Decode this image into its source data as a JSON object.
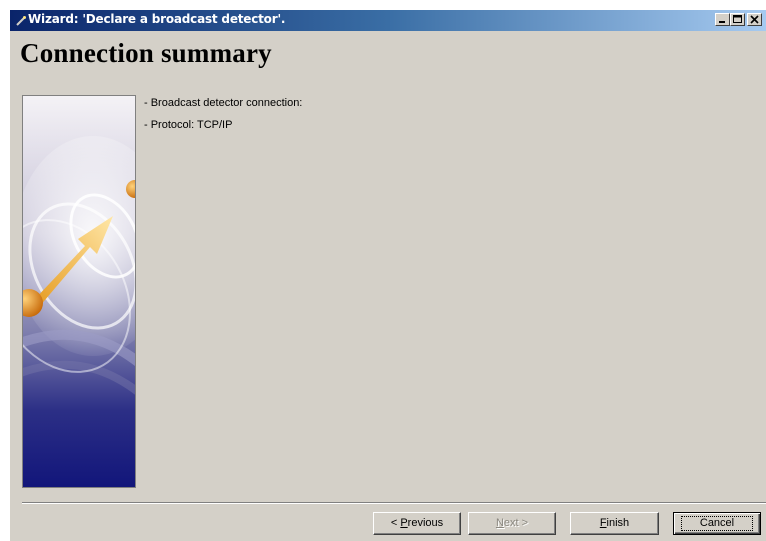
{
  "window": {
    "title": "Wizard: 'Declare a broadcast detector'.",
    "icon": "wizard-icon",
    "controls": {
      "minimize": "minimize-icon",
      "maximize": "maximize-icon",
      "close": "close-icon"
    }
  },
  "page": {
    "heading": "Connection summary",
    "summary_lines": [
      "- Broadcast detector connection:",
      "- Protocol: TCP/IP"
    ]
  },
  "buttons": {
    "previous": {
      "prefix": "< ",
      "mnemonic": "P",
      "rest": "revious"
    },
    "next": {
      "mnemonic": "N",
      "rest": "ext >"
    },
    "finish": {
      "mnemonic": "F",
      "rest": "inish"
    },
    "cancel": "Cancel"
  },
  "colors": {
    "titlebar_start": "#0a246a",
    "titlebar_end": "#a6caf0",
    "dialog_bg": "#d4d0c8"
  }
}
